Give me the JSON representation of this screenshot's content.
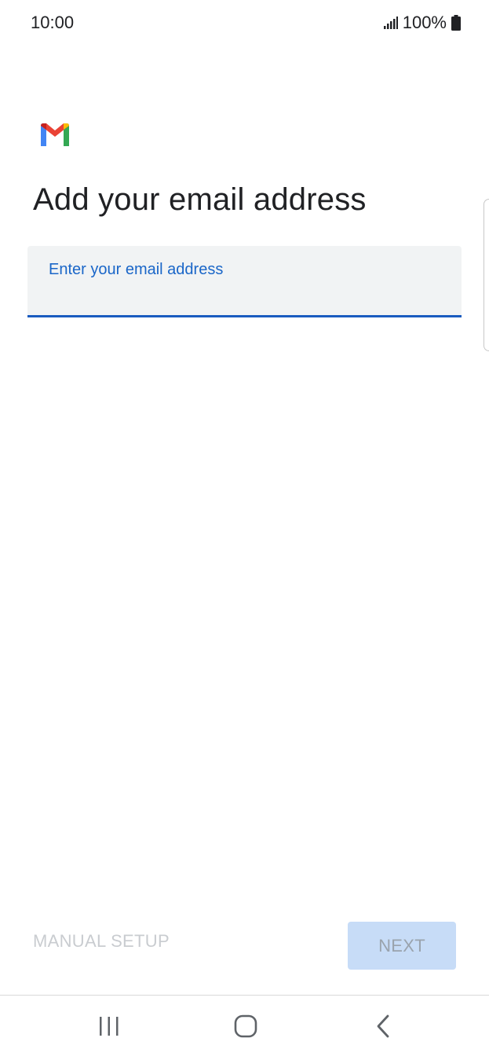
{
  "status_bar": {
    "time": "10:00",
    "battery": "100%"
  },
  "icons": {
    "signal": "signal-icon",
    "battery": "battery-icon",
    "logo": "gmail-logo-icon",
    "recent_apps": "recent-apps-icon",
    "home": "home-icon",
    "back": "back-icon"
  },
  "page": {
    "title": "Add your email address"
  },
  "email_field": {
    "label": "Enter your email address",
    "value": ""
  },
  "actions": {
    "manual_setup_label": "MANUAL SETUP",
    "next_label": "NEXT"
  },
  "colors": {
    "accent": "#1a5bbf",
    "label_blue": "#1a66c8",
    "field_bg": "#f1f3f4",
    "next_bg_disabled": "#c7dcf7",
    "disabled_text": "#c9ccd0"
  }
}
